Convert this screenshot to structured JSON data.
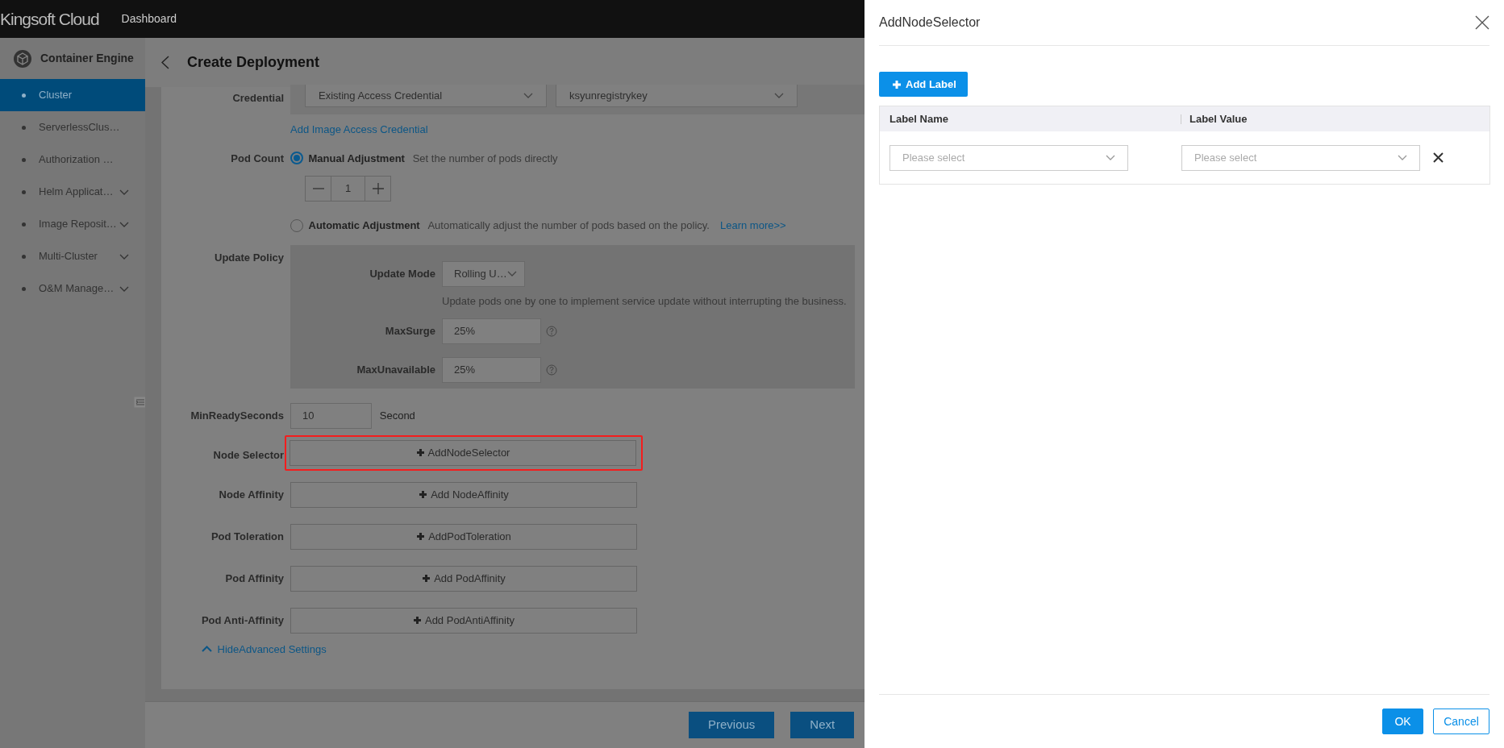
{
  "top_bar": {
    "brand": "Kingsoft Cloud",
    "nav": "Dashboard"
  },
  "sidebar": {
    "title": "Container Engine",
    "items": [
      {
        "label": "Cluster",
        "selected": true,
        "expandable": false
      },
      {
        "label": "ServerlessClus…",
        "selected": false,
        "expandable": false
      },
      {
        "label": "Authorization …",
        "selected": false,
        "expandable": false
      },
      {
        "label": "Helm Applicat…",
        "selected": false,
        "expandable": true
      },
      {
        "label": "Image Reposit…",
        "selected": false,
        "expandable": true
      },
      {
        "label": "Multi-Cluster",
        "selected": false,
        "expandable": true
      },
      {
        "label": "O&M Manage…",
        "selected": false,
        "expandable": true
      }
    ]
  },
  "page": {
    "title": "Create Deployment"
  },
  "form": {
    "credential": {
      "label": "Credential",
      "type_select": "Existing Access Credential",
      "secret_select": "ksyunregistrykey",
      "add_link": "Add Image Access Credential"
    },
    "pod_count": {
      "label": "Pod Count",
      "stepper_value": "1",
      "options": [
        {
          "label": "Manual Adjustment",
          "hint": "Set the number of pods directly",
          "selected": true
        },
        {
          "label": "Automatic Adjustment",
          "hint": "Automatically adjust the number of pods based on the policy.",
          "link": "Learn more>>",
          "selected": false
        }
      ]
    },
    "update_policy": {
      "label": "Update Policy",
      "fields": [
        {
          "kind": "select",
          "label": "Update Mode",
          "value": "Rolling U…",
          "help": "Update pods one by one to implement service update without interrupting the business."
        },
        {
          "kind": "input",
          "label": "MaxSurge",
          "value": "25%",
          "info": true
        },
        {
          "kind": "input",
          "label": "MaxUnavailable",
          "value": "25%",
          "info": true
        }
      ]
    },
    "min_ready": {
      "label": "MinReadySeconds",
      "value": "10",
      "unit": "Second"
    },
    "add_rows": [
      {
        "label": "Node Selector",
        "button": "AddNodeSelector",
        "highlighted": true
      },
      {
        "label": "Node Affinity",
        "button": "Add NodeAffinity",
        "highlighted": false
      },
      {
        "label": "Pod Toleration",
        "button": "AddPodToleration",
        "highlighted": false
      },
      {
        "label": "Pod Affinity",
        "button": "Add PodAffinity",
        "highlighted": false
      },
      {
        "label": "Pod Anti-Affinity",
        "button": "Add PodAntiAffinity",
        "highlighted": false
      }
    ],
    "toggle": "HideAdvanced Settings"
  },
  "footer": {
    "buttons": [
      "Previous",
      "Next"
    ]
  },
  "drawer": {
    "title": "AddNodeSelector",
    "add_button": "Add Label",
    "columns": [
      "Label Name",
      "Label Value"
    ],
    "rows": [
      {
        "name_placeholder": "Please select",
        "value_placeholder": "Please select"
      }
    ],
    "buttons": [
      {
        "label": "OK",
        "kind": "primary"
      },
      {
        "label": "Cancel",
        "kind": "secondary"
      }
    ]
  }
}
